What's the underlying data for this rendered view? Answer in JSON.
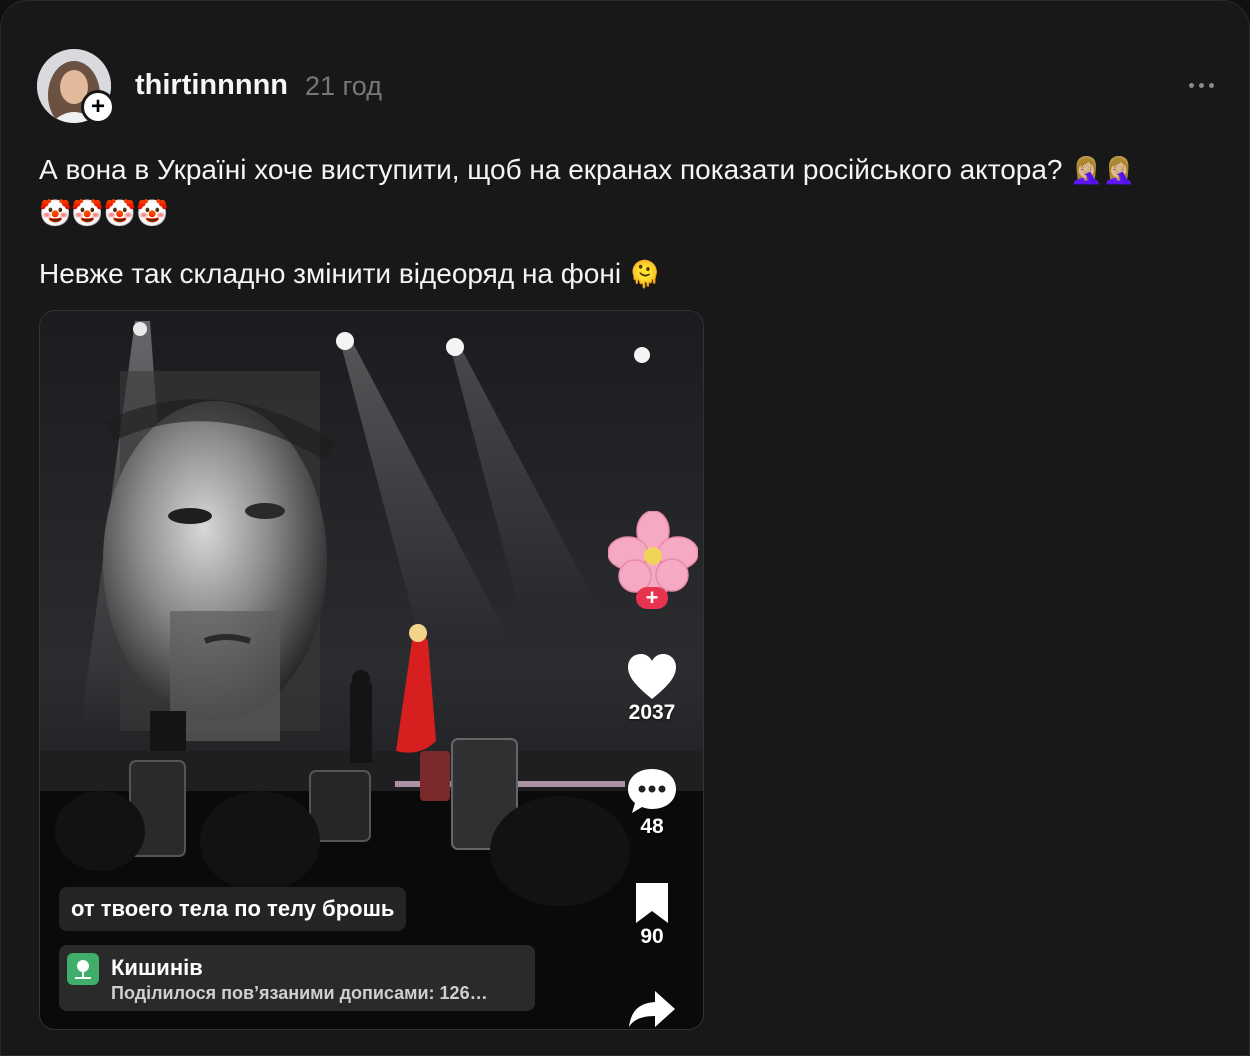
{
  "post": {
    "username": "thirtinnnnn",
    "timestamp": "21 год",
    "paragraph1": "А вона в Україні хоче виступити, щоб на екранах показати російського актора?",
    "paragraph1_emojis": "🤦🏼‍♀️🤦🏼‍♀️🤡🤡🤡🤡",
    "paragraph2": "Невже так складно змінити відеоряд на фоні",
    "paragraph2_emoji": "🫠"
  },
  "video": {
    "caption": "от твоего тела по телу брошь",
    "location_title": "Кишинів",
    "location_subtitle": "Поділилося пов’язаними дописами: 126…",
    "likes": "2037",
    "comments": "48",
    "saves": "90",
    "icons": [
      "heart-icon",
      "comment-icon",
      "bookmark-icon",
      "share-icon",
      "location-pin-icon"
    ]
  },
  "icons": {
    "follow_plus": "+",
    "more": "more-horizontal-icon"
  }
}
